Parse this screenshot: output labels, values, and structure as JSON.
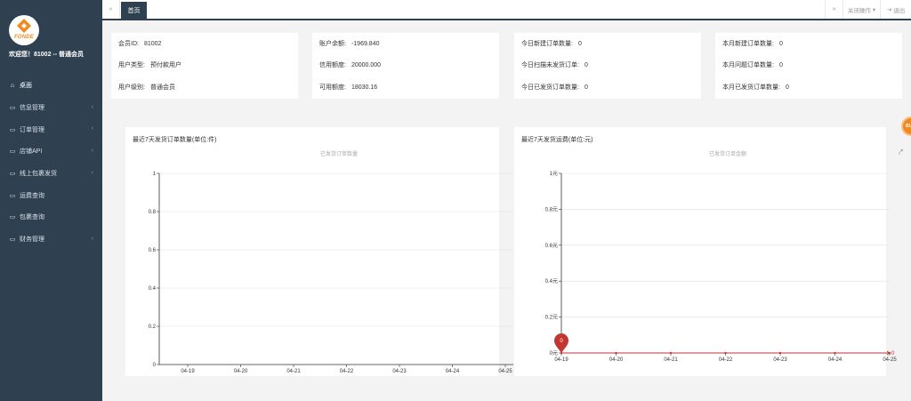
{
  "sidebar": {
    "logo_text": "FONDE",
    "welcome": "欢迎您！81002 -- 普通会员",
    "items": [
      {
        "label": "桌面",
        "icon": "home-icon",
        "has_children": false
      },
      {
        "label": "信息管理",
        "icon": "window-icon",
        "has_children": true
      },
      {
        "label": "订单管理",
        "icon": "window-icon",
        "has_children": true
      },
      {
        "label": "店铺API",
        "icon": "window-icon",
        "has_children": true
      },
      {
        "label": "线上包裹发货",
        "icon": "window-icon",
        "has_children": true
      },
      {
        "label": "运费查询",
        "icon": "window-icon",
        "has_children": false
      },
      {
        "label": "包裹查询",
        "icon": "window-icon",
        "has_children": false
      },
      {
        "label": "财务管理",
        "icon": "window-icon",
        "has_children": true
      }
    ]
  },
  "topbar": {
    "tab_label": "首页",
    "close_ops": "关闭操作",
    "logout": "退出"
  },
  "cards": [
    {
      "rows": [
        {
          "k": "会员ID:",
          "v": "81002"
        },
        {
          "k": "用户类型:",
          "v": "预付款用户"
        },
        {
          "k": "用户级别:",
          "v": "普通会员"
        }
      ]
    },
    {
      "rows": [
        {
          "k": "账户余额:",
          "v": "-1969.840"
        },
        {
          "k": "信用额度:",
          "v": "20000.000"
        },
        {
          "k": "可用额度:",
          "v": "18030.16"
        }
      ]
    },
    {
      "rows": [
        {
          "k": "今日新建订单数量:",
          "v": "0"
        },
        {
          "k": "今日扫描未发货订单:",
          "v": "0"
        },
        {
          "k": "今日已发货订单数量:",
          "v": "0"
        }
      ]
    },
    {
      "rows": [
        {
          "k": "本月新建订单数量:",
          "v": "0"
        },
        {
          "k": "本月问题订单数量:",
          "v": "0"
        },
        {
          "k": "本月已发货订单数量:",
          "v": "0"
        }
      ]
    }
  ],
  "float_badge": "BU",
  "chart_data": [
    {
      "type": "line",
      "title": "最近7天发货订单数量(单位:件)",
      "legend": "已发货订单数量",
      "categories": [
        "04-19",
        "04-20",
        "04-21",
        "04-22",
        "04-23",
        "04-24",
        "04-25"
      ],
      "yticks": [
        "0",
        "0.2",
        "0.4",
        "0.6",
        "0.8",
        "1"
      ],
      "ylim": [
        0,
        1
      ],
      "series": [
        {
          "values": []
        }
      ]
    },
    {
      "type": "line",
      "title": "最近7天发货运费(单位:元)",
      "legend": "已发货订单金额",
      "categories": [
        "04-19",
        "04-20",
        "04-21",
        "04-22",
        "04-23",
        "04-24",
        "04-25"
      ],
      "yticks": [
        "0元",
        "0.2元",
        "0.4元",
        "0.6元",
        "0.8元",
        "1元"
      ],
      "ylim": [
        0,
        1
      ],
      "series": [
        {
          "values": [
            0,
            0,
            0,
            0,
            0,
            0,
            0
          ]
        }
      ],
      "max_marker": "0",
      "end_label": "0",
      "line_color": "#c23531"
    }
  ]
}
